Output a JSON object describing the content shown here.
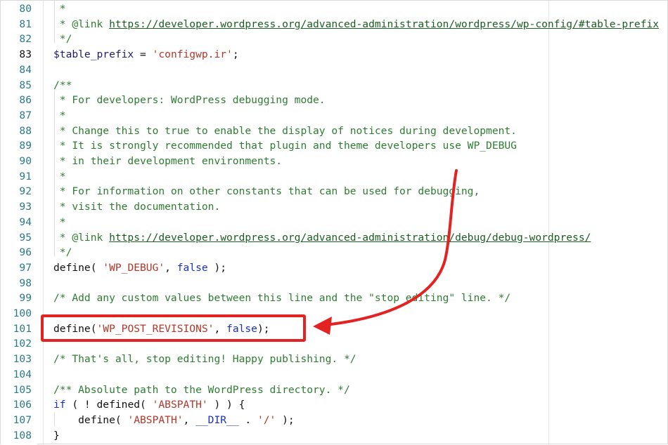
{
  "editor": {
    "active_line": "83",
    "accent_color": "#e32222",
    "lines": [
      {
        "n": "80",
        "segs": [
          {
            "t": " *",
            "c": "cmt"
          }
        ]
      },
      {
        "n": "81",
        "segs": [
          {
            "t": " * @link ",
            "c": "cmt"
          },
          {
            "t": "https://developer.wordpress.org/advanced-administration/wordpress/wp-config/#table-prefix",
            "c": "link"
          }
        ]
      },
      {
        "n": "82",
        "segs": [
          {
            "t": " */",
            "c": "cmt"
          }
        ]
      },
      {
        "n": "83",
        "segs": [
          {
            "t": "$table_prefix",
            "c": "var"
          },
          {
            "t": " = ",
            "c": "fn"
          },
          {
            "t": "'configwp.ir'",
            "c": "str"
          },
          {
            "t": ";",
            "c": "fn"
          }
        ]
      },
      {
        "n": "84",
        "segs": []
      },
      {
        "n": "85",
        "segs": [
          {
            "t": "/**",
            "c": "cmt"
          }
        ]
      },
      {
        "n": "86",
        "segs": [
          {
            "t": " * For developers: WordPress debugging mode.",
            "c": "cmt"
          }
        ]
      },
      {
        "n": "87",
        "segs": [
          {
            "t": " *",
            "c": "cmt"
          }
        ]
      },
      {
        "n": "88",
        "segs": [
          {
            "t": " * Change this to true to enable the display of notices during development.",
            "c": "cmt"
          }
        ]
      },
      {
        "n": "89",
        "segs": [
          {
            "t": " * It is strongly recommended that plugin and theme developers use WP_DEBUG",
            "c": "cmt"
          }
        ]
      },
      {
        "n": "90",
        "segs": [
          {
            "t": " * in their development environments.",
            "c": "cmt"
          }
        ]
      },
      {
        "n": "91",
        "segs": [
          {
            "t": " *",
            "c": "cmt"
          }
        ]
      },
      {
        "n": "92",
        "segs": [
          {
            "t": " * For information on other constants that can be used for debugging,",
            "c": "cmt"
          }
        ]
      },
      {
        "n": "93",
        "segs": [
          {
            "t": " * visit the documentation.",
            "c": "cmt"
          }
        ]
      },
      {
        "n": "94",
        "segs": [
          {
            "t": " *",
            "c": "cmt"
          }
        ]
      },
      {
        "n": "95",
        "segs": [
          {
            "t": " * @link ",
            "c": "cmt"
          },
          {
            "t": "https://developer.wordpress.org/advanced-administration/debug/debug-wordpress/",
            "c": "link"
          }
        ]
      },
      {
        "n": "96",
        "segs": [
          {
            "t": " */",
            "c": "cmt"
          }
        ]
      },
      {
        "n": "97",
        "segs": [
          {
            "t": "define",
            "c": "fn"
          },
          {
            "t": "( ",
            "c": "fn"
          },
          {
            "t": "'WP_DEBUG'",
            "c": "str"
          },
          {
            "t": ", ",
            "c": "fn"
          },
          {
            "t": "false",
            "c": "kw"
          },
          {
            "t": " );",
            "c": "fn"
          }
        ]
      },
      {
        "n": "98",
        "segs": []
      },
      {
        "n": "99",
        "segs": [
          {
            "t": "/* Add any custom values between this line and the \"stop editing\" line. */",
            "c": "cmt"
          }
        ]
      },
      {
        "n": "100",
        "segs": []
      },
      {
        "n": "101",
        "segs": [
          {
            "t": "define",
            "c": "fn"
          },
          {
            "t": "(",
            "c": "fn"
          },
          {
            "t": "'WP_POST_REVISIONS'",
            "c": "str"
          },
          {
            "t": ", ",
            "c": "fn"
          },
          {
            "t": "false",
            "c": "kw"
          },
          {
            "t": ");",
            "c": "fn"
          }
        ]
      },
      {
        "n": "102",
        "segs": []
      },
      {
        "n": "103",
        "segs": [
          {
            "t": "/* That's all, stop editing! Happy publishing. */",
            "c": "cmt"
          }
        ]
      },
      {
        "n": "104",
        "segs": []
      },
      {
        "n": "105",
        "segs": [
          {
            "t": "/** Absolute path to the WordPress directory. */",
            "c": "cmt"
          }
        ]
      },
      {
        "n": "106",
        "segs": [
          {
            "t": "if",
            "c": "kw"
          },
          {
            "t": " ( ! ",
            "c": "fn"
          },
          {
            "t": "defined",
            "c": "fn"
          },
          {
            "t": "( ",
            "c": "fn"
          },
          {
            "t": "'ABSPATH'",
            "c": "str"
          },
          {
            "t": " ) ) {",
            "c": "fn"
          }
        ]
      },
      {
        "n": "107",
        "segs": [
          {
            "t": "    define",
            "c": "fn"
          },
          {
            "t": "( ",
            "c": "fn"
          },
          {
            "t": "'ABSPATH'",
            "c": "str"
          },
          {
            "t": ", ",
            "c": "fn"
          },
          {
            "t": "__DIR__",
            "c": "kw"
          },
          {
            "t": " . ",
            "c": "fn"
          },
          {
            "t": "'/'",
            "c": "str"
          },
          {
            "t": " );",
            "c": "fn"
          }
        ]
      },
      {
        "n": "108",
        "segs": [
          {
            "t": "}",
            "c": "fn"
          }
        ]
      }
    ]
  }
}
